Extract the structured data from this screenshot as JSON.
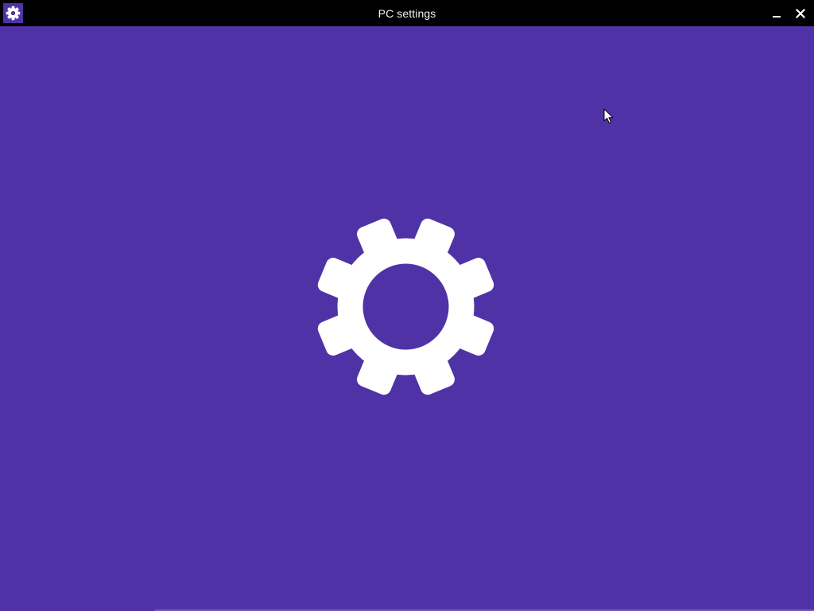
{
  "window": {
    "title": "PC settings",
    "app_icon": "gear-icon",
    "minimize_icon": "minimize-icon",
    "close_icon": "close-icon"
  },
  "splash": {
    "icon": "gear-icon"
  },
  "pointer": {
    "icon": "mouse-pointer-icon"
  },
  "colors": {
    "accent_background": "#4f33a6",
    "titlebar": "#000000",
    "icon_foreground": "#ffffff",
    "title_text": "#f2f2f2"
  }
}
